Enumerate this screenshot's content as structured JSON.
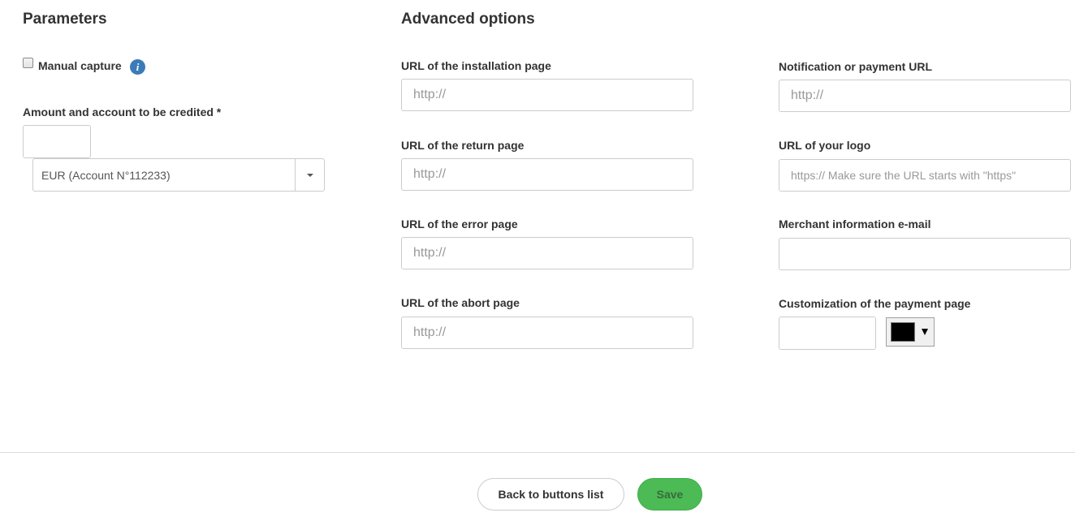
{
  "parameters": {
    "heading": "Parameters",
    "manual_capture_label": "Manual capture",
    "info_icon_glyph": "i",
    "amount_label": "Amount and account to be credited *",
    "amount_value": "",
    "account_select_value": "EUR (Account N°112233)"
  },
  "advanced": {
    "heading": "Advanced options",
    "installation_label": "URL of the installation page",
    "installation_placeholder": "http://",
    "return_label": "URL of the return page",
    "return_placeholder": "http://",
    "error_label": "URL of the error page",
    "error_placeholder": "http://",
    "abort_label": "URL of the abort page",
    "abort_placeholder": "http://",
    "notification_label": "Notification or payment URL",
    "notification_placeholder": "http://",
    "logo_label": "URL of your logo",
    "logo_placeholder": "https:// Make sure the URL starts with \"https\"",
    "merchant_email_label": "Merchant information e-mail",
    "merchant_email_placeholder": "",
    "customization_label": "Customization of the payment page",
    "customization_value": "",
    "picker_color": "#000000"
  },
  "footer": {
    "back_label": "Back to buttons list",
    "save_label": "Save",
    "save_color": "#4cbb55"
  }
}
